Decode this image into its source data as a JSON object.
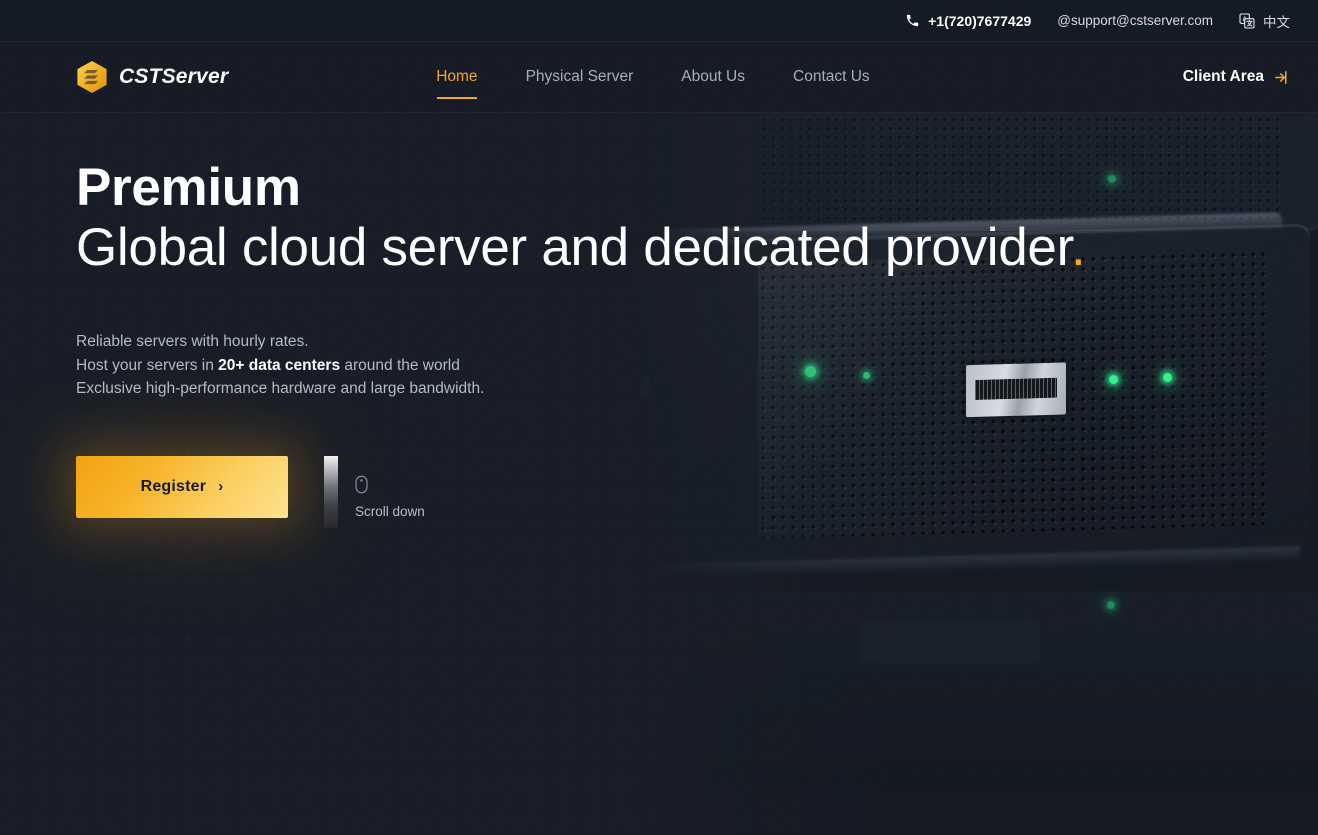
{
  "topbar": {
    "phone": "+1(720)7677429",
    "email": "@support@cstserver.com",
    "language": "中文",
    "phone_icon": "phone-icon",
    "translate_icon": "translate-icon"
  },
  "brand": {
    "name": "CSTServer",
    "logo_icon": "stacked-layers-hexagon-logo-icon",
    "accent_color": "#f5a623"
  },
  "nav": {
    "items": [
      {
        "label": "Home",
        "active": true
      },
      {
        "label": "Physical Server",
        "active": false
      },
      {
        "label": "About Us",
        "active": false
      },
      {
        "label": "Contact Us",
        "active": false
      }
    ],
    "client_area": {
      "label": "Client Area",
      "icon": "sign-in-arrow-icon"
    }
  },
  "hero": {
    "headline_lead": "Premium",
    "headline_rest": "Global cloud server and dedicated provider",
    "headline_dot": ".",
    "subcopy": {
      "line1": "Reliable servers with hourly rates.",
      "line2_pre": "Host your servers in ",
      "line2_strong": "20+ data centers",
      "line2_post": " around the world",
      "line3": "Exclusive high-performance hardware and large bandwidth."
    },
    "cta": {
      "label": "Register",
      "chevron": "›"
    },
    "scroll": {
      "label": "Scroll down",
      "mouse_icon": "mouse-scroll-icon"
    },
    "background_image_alt": "dark server rack with green status LEDs"
  },
  "colors": {
    "page_background": "#181d27",
    "accent_gold": "#f5a623",
    "led_green": "#35f08e",
    "text_primary": "#ffffff",
    "text_muted": "#b4bac6"
  }
}
